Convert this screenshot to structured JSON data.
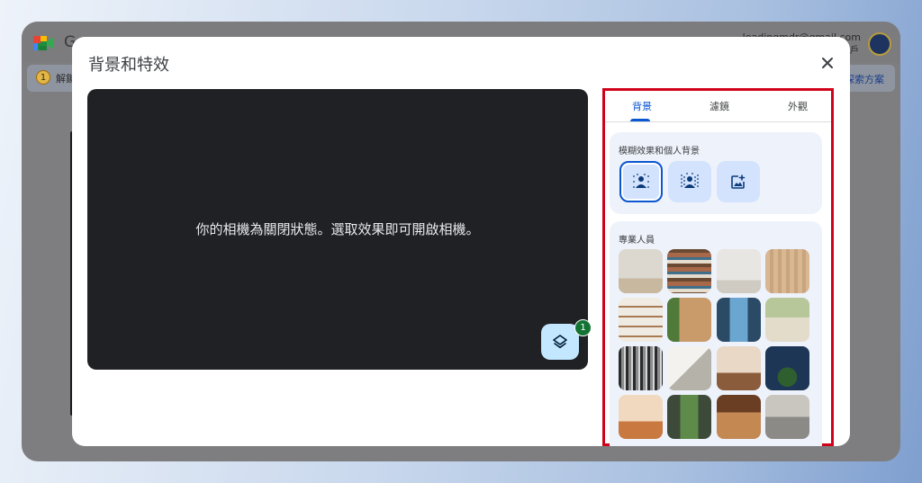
{
  "browser": {
    "app_initial": "G",
    "account_email": "leadingmdr@gmail.com",
    "account_switch": "切換帳戶",
    "notice_number": "1",
    "notice_text": "解鎖",
    "notice_link": "探索方案"
  },
  "dialog": {
    "title": "背景和特效",
    "preview_message": "你的相機為關閉狀態。選取效果即可開啟相機。",
    "effects_badge": "1",
    "tabs": [
      {
        "label": "背景",
        "active": true
      },
      {
        "label": "濾鏡",
        "active": false
      },
      {
        "label": "外觀",
        "active": false
      }
    ],
    "blur_section": {
      "title": "模糊效果和個人背景",
      "options": [
        {
          "icon": "slight-blur-icon",
          "selected": true
        },
        {
          "icon": "blur-icon",
          "selected": false
        },
        {
          "icon": "add-image-icon",
          "selected": false
        }
      ]
    },
    "professional_section": {
      "title": "專業人員",
      "backgrounds": [
        "minimal-room",
        "bookshelf-library",
        "white-studio",
        "wood-panel-room",
        "wall-shelves",
        "plant-wood-wall",
        "glass-window",
        "interior-plants",
        "dark-bookcase",
        "sunlit-corner",
        "warm-doorway",
        "night-plant",
        "boho-living",
        "courtyard-garden",
        "cafe-interior",
        "office-lobby"
      ]
    }
  },
  "colors": {
    "accent": "#0b57d0",
    "highlight_border": "#d0021b",
    "preview_bg": "#202124",
    "badge": "#137333"
  }
}
